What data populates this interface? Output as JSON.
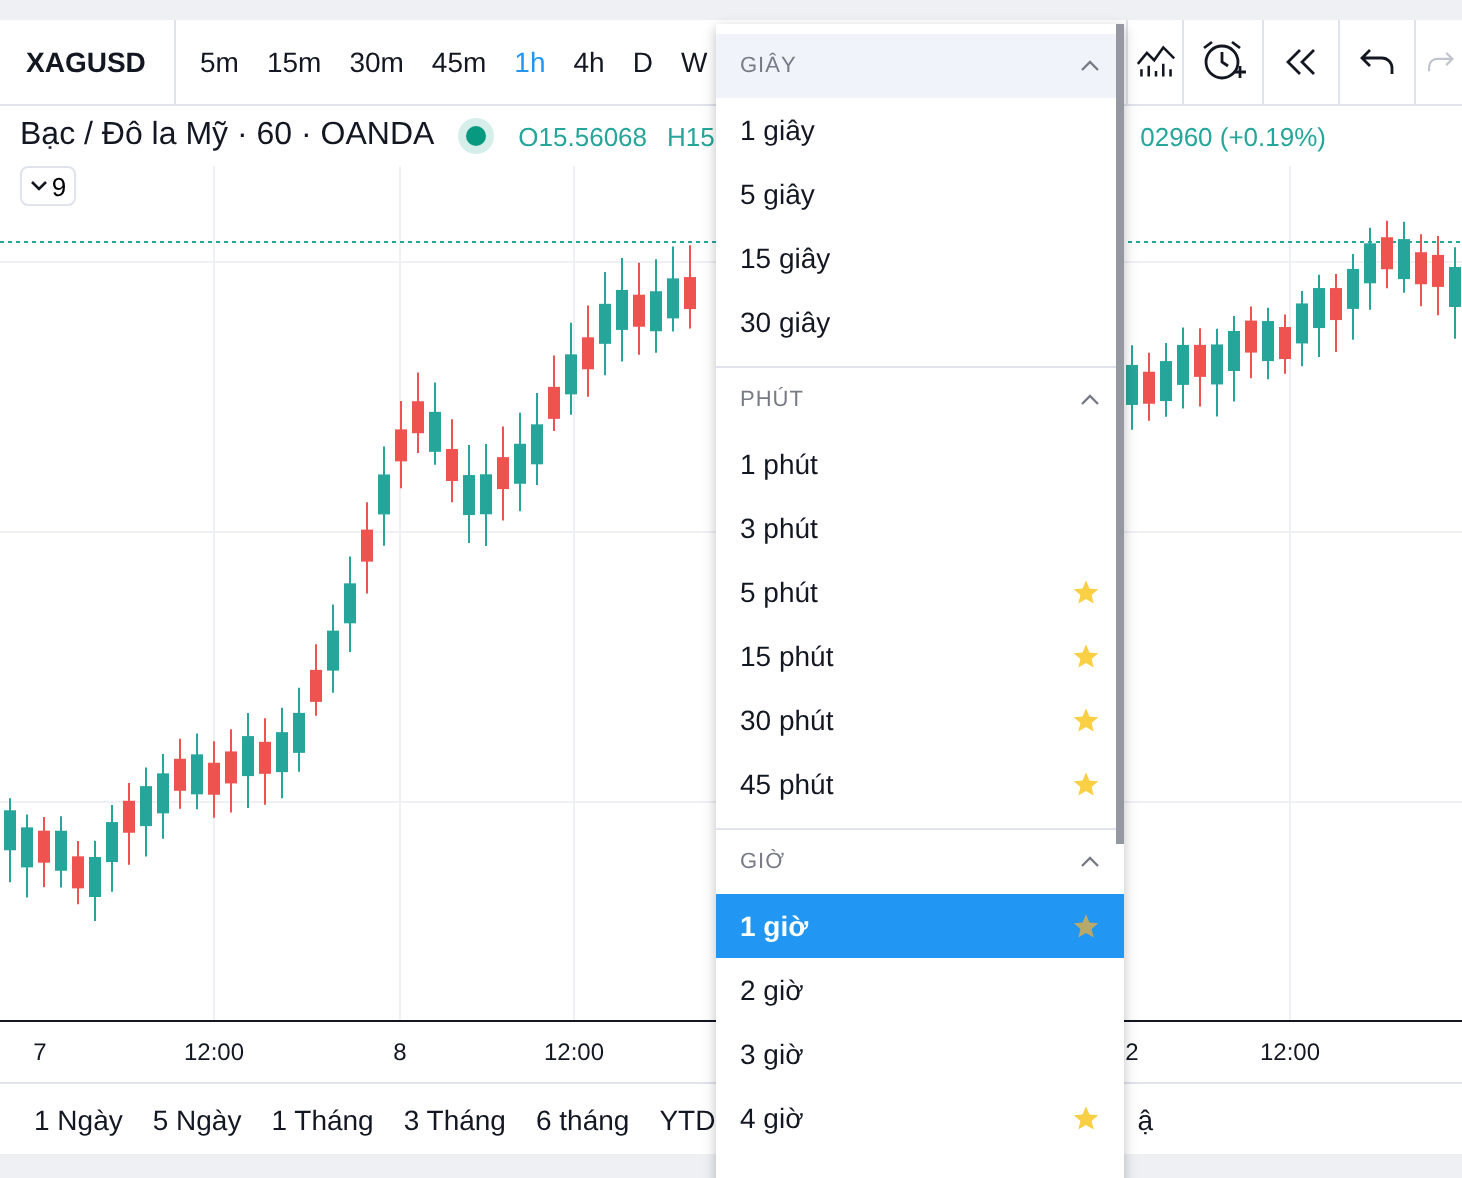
{
  "symbol": "XAGUSD",
  "intervals": [
    {
      "label": "5m",
      "selected": false
    },
    {
      "label": "15m",
      "selected": false
    },
    {
      "label": "30m",
      "selected": false
    },
    {
      "label": "45m",
      "selected": false
    },
    {
      "label": "1h",
      "selected": true
    },
    {
      "label": "4h",
      "selected": false
    },
    {
      "label": "D",
      "selected": false
    },
    {
      "label": "W",
      "selected": false
    }
  ],
  "legend": {
    "title": "Bạc / Đô la Mỹ · 60 · OANDA",
    "open": "O15.56068",
    "high": "H15",
    "change": "02960 (+0.19%)",
    "indicators_count": "9"
  },
  "time_axis": [
    "7",
    "12:00",
    "8",
    "12:00",
    "2",
    "12:00"
  ],
  "ranges": [
    "1 Ngày",
    "5 Ngày",
    "1 Tháng",
    "3 Tháng",
    "6 tháng",
    "YTD",
    "ậ"
  ],
  "menu": {
    "sections": [
      {
        "title": "GIÂY",
        "expanded": true,
        "items": [
          {
            "label": "1 giây",
            "favorite": false,
            "selected": false
          },
          {
            "label": "5 giây",
            "favorite": false,
            "selected": false
          },
          {
            "label": "15 giây",
            "favorite": false,
            "selected": false
          },
          {
            "label": "30 giây",
            "favorite": false,
            "selected": false
          }
        ]
      },
      {
        "title": "PHÚT",
        "expanded": true,
        "items": [
          {
            "label": "1 phút",
            "favorite": false,
            "selected": false
          },
          {
            "label": "3 phút",
            "favorite": false,
            "selected": false
          },
          {
            "label": "5 phút",
            "favorite": true,
            "selected": false
          },
          {
            "label": "15 phút",
            "favorite": true,
            "selected": false
          },
          {
            "label": "30 phút",
            "favorite": true,
            "selected": false
          },
          {
            "label": "45 phút",
            "favorite": true,
            "selected": false
          }
        ]
      },
      {
        "title": "GIỜ",
        "expanded": true,
        "items": [
          {
            "label": "1 giờ",
            "favorite": true,
            "selected": true
          },
          {
            "label": "2 giờ",
            "favorite": false,
            "selected": false
          },
          {
            "label": "3 giờ",
            "favorite": false,
            "selected": false
          },
          {
            "label": "4 giờ",
            "favorite": true,
            "selected": false
          }
        ]
      }
    ]
  }
}
